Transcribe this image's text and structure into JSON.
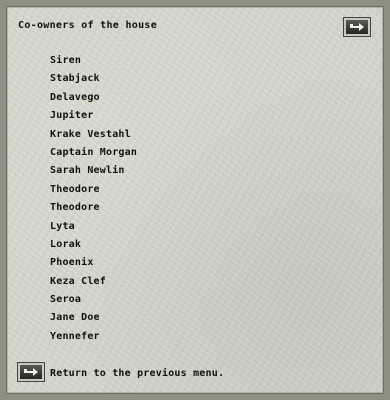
{
  "dialog": {
    "title": "Co-owners of the house",
    "owners": [
      "Siren",
      "Stabjack",
      "Delavego",
      "Jupiter",
      "Krake Vestahl",
      "Captain Morgan",
      "Sarah Newlin",
      "Theodore",
      "Theodore",
      "Lyta",
      "Lorak",
      "Phoenix",
      "Keza Clef",
      "Seroa",
      "Jane Doe",
      "Yennefer"
    ],
    "return_label": "Return to the previous menu."
  },
  "icons": {
    "close_button": "arrow-right-icon",
    "return_button": "arrow-right-icon"
  },
  "colors": {
    "panel_background": "#d6d6cc",
    "text": "#111111",
    "button_face": "#3a3a38"
  }
}
